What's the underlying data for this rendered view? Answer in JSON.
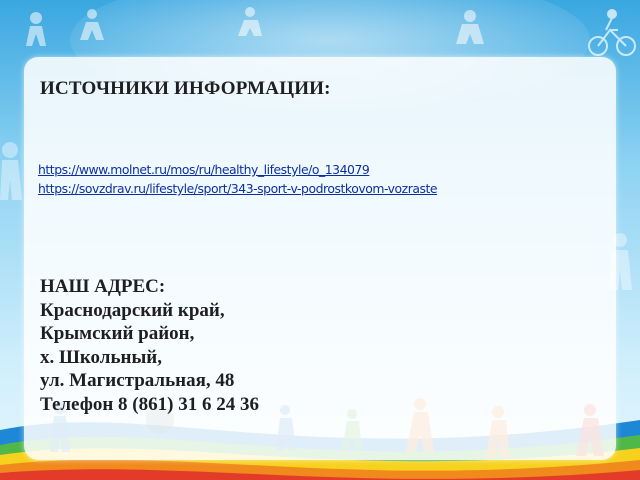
{
  "heading": "ИСТОЧНИКИ ИНФОРМАЦИИ:",
  "links": [
    "https://www.molnet.ru/mos/ru/healthy_lifestyle/o_134079",
    "https://sovzdrav.ru/lifestyle/sport/343-sport-v-podrostkovom-vozraste"
  ],
  "address": {
    "title": "НАШ АДРЕС:",
    "lines": [
      "Краснодарский край,",
      "Крымский район,",
      "х. Школьный,",
      "ул. Магистральная, 48",
      "Телефон 8 (861) 31 6 24 36"
    ]
  },
  "colors": {
    "sky_top": "#3aa7e0",
    "sky_light": "#cfeefb",
    "link": "#0b2fa3",
    "stripe_yellow": "#f6d21e",
    "stripe_orange": "#f08a1c",
    "stripe_red": "#e23b2a",
    "stripe_green": "#4fb848",
    "stripe_blue": "#1e88d6"
  },
  "decorations": [
    "athlete-silhouettes",
    "ball-icon",
    "bicycle-icon",
    "rainbow-stripes"
  ]
}
